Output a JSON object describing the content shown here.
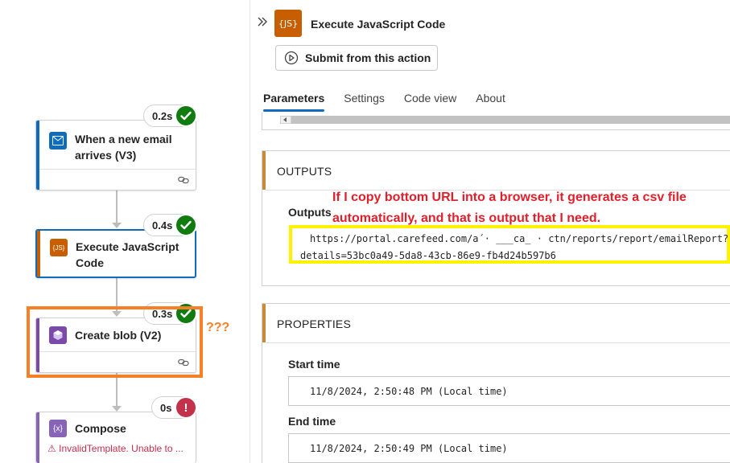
{
  "flow": {
    "steps": [
      {
        "title": "When a new email arrives (V3)",
        "duration": "0.2s",
        "status": "success",
        "accent": "#0f6cbd",
        "icon": "outlook-icon"
      },
      {
        "title": "Execute JavaScript Code",
        "duration": "0.4s",
        "status": "success",
        "accent": "#c75f00",
        "icon": "javascript-icon"
      },
      {
        "title": "Create blob (V2)",
        "duration": "0.3s",
        "status": "success",
        "accent": "#7b4aa8",
        "icon": "blob-storage-icon"
      },
      {
        "title": "Compose",
        "duration": "0s",
        "status": "error",
        "accent": "#8764b8",
        "icon": "compose-icon",
        "error": "InvalidTemplate. Unable to ..."
      }
    ],
    "annotation_marks": "???",
    "colors": {
      "success": "#107c10",
      "error": "#c4314b",
      "highlight": "#f58025"
    }
  },
  "panel": {
    "title": "Execute JavaScript Code",
    "js_icon_text": "{JS}",
    "submit_label": "Submit from this action",
    "tabs": [
      "Parameters",
      "Settings",
      "Code view",
      "About"
    ],
    "active_tab": "Parameters",
    "outputs": {
      "header": "OUTPUTS",
      "label": "Outputs",
      "annotation": "If I copy bottom URL into a browser, it generates a csv file automatically, and that is output that I need.",
      "url_line1": "https://portal.carefeed.com/a´· ___ca_ · ctn/reports/report/emailReport?",
      "url_line2": "details=53bc0a49-5da8-43cb-86e9-fb4d24b597b6"
    },
    "properties": {
      "header": "PROPERTIES",
      "start_label": "Start time",
      "start_value": "11/8/2024, 2:50:48 PM (Local time)",
      "end_label": "End time",
      "end_value": "11/8/2024, 2:50:49 PM (Local time)"
    }
  }
}
